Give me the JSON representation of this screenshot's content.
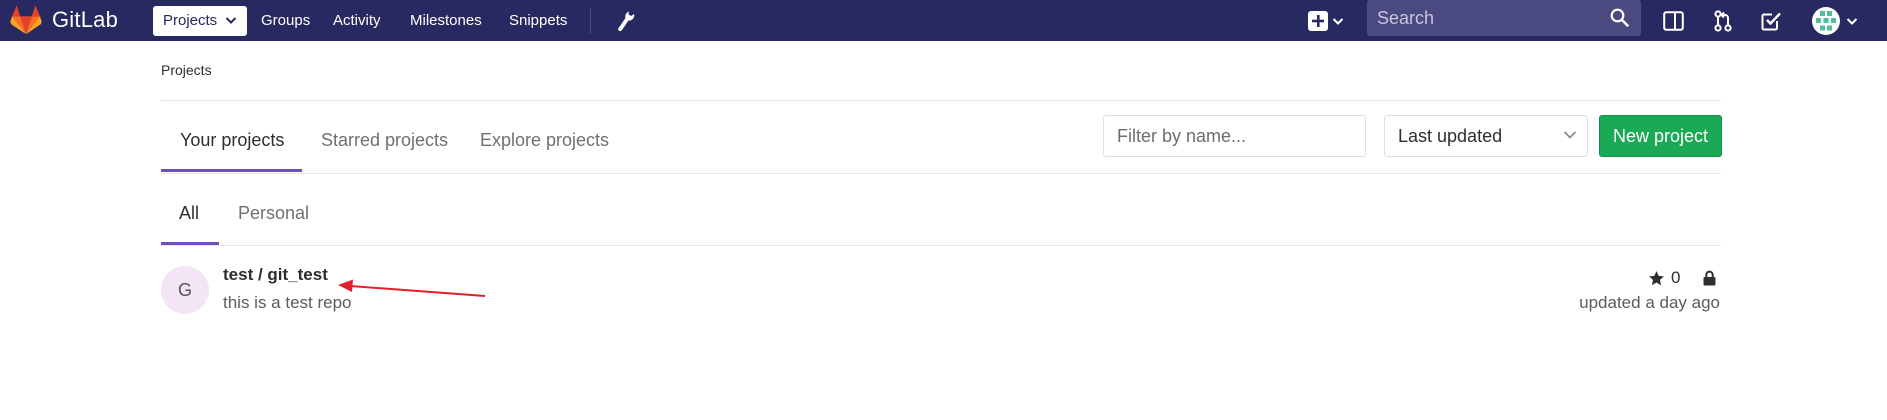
{
  "app": {
    "title": "GitLab"
  },
  "navbar": {
    "items": [
      {
        "label": "Projects",
        "active": true
      },
      {
        "label": "Groups"
      },
      {
        "label": "Activity"
      },
      {
        "label": "Milestones"
      },
      {
        "label": "Snippets"
      }
    ],
    "search": {
      "placeholder": "Search"
    },
    "icons": [
      "wrench-icon",
      "plus-square-icon",
      "sidebar-toggle-icon",
      "merge-request-icon",
      "todo-check-icon",
      "user-avatar"
    ]
  },
  "breadcrumb": {
    "label": "Projects"
  },
  "tabs": {
    "main": [
      "Your projects",
      "Starred projects",
      "Explore projects"
    ],
    "sub": [
      "All",
      "Personal"
    ]
  },
  "filter": {
    "placeholder": "Filter by name..."
  },
  "sort": {
    "selected": "Last updated"
  },
  "new_project_button": "New project",
  "projects": [
    {
      "avatar_letter": "G",
      "name": "test / git_test",
      "description": "this is a test repo",
      "stars": "0",
      "visibility": "private",
      "updated": "updated a day ago"
    }
  ],
  "colors": {
    "navbar": "#292961",
    "accent": "#6b4fbb",
    "success": "#1aaa55",
    "annotation_arrow": "#e0202a"
  }
}
